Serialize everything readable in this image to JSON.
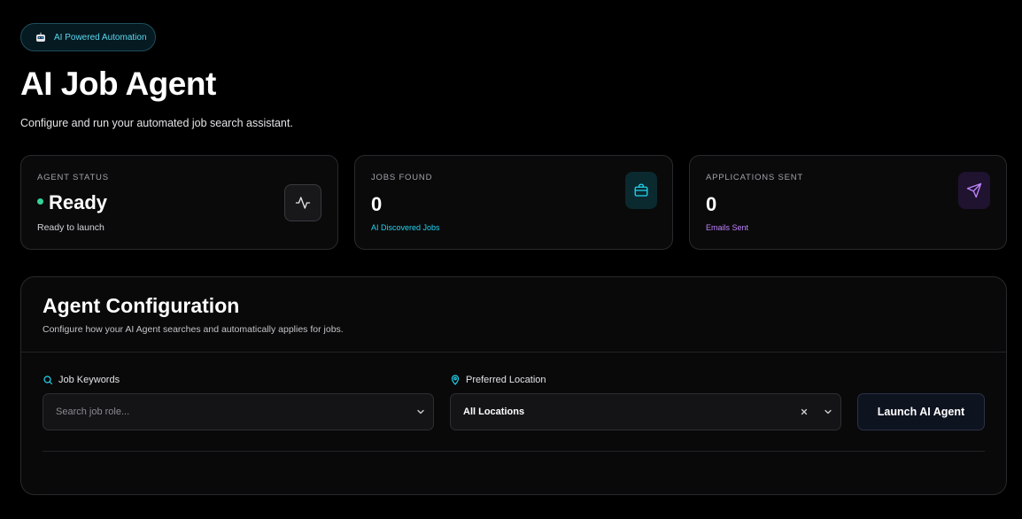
{
  "badge": {
    "label": "AI Powered Automation",
    "icon": "robot-icon"
  },
  "header": {
    "title": "AI Job Agent",
    "subtitle": "Configure and run your automated job search assistant."
  },
  "stats": {
    "agent_status": {
      "label": "AGENT STATUS",
      "value": "Ready",
      "sub": "Ready to launch",
      "icon": "activity-icon",
      "dot_color": "#34d399"
    },
    "jobs_found": {
      "label": "JOBS FOUND",
      "value": "0",
      "sub": "AI Discovered Jobs",
      "icon": "briefcase-icon",
      "accent": "#22d3ee"
    },
    "applications_sent": {
      "label": "APPLICATIONS SENT",
      "value": "0",
      "sub": "Emails Sent",
      "icon": "send-icon",
      "accent": "#c084fc"
    }
  },
  "config": {
    "title": "Agent Configuration",
    "description": "Configure how your AI Agent searches and automatically applies for jobs.",
    "keywords": {
      "label": "Job Keywords",
      "placeholder": "Search job role...",
      "icon": "search-icon"
    },
    "location": {
      "label": "Preferred Location",
      "value": "All Locations",
      "icon": "map-pin-icon"
    },
    "launch_label": "Launch AI Agent"
  }
}
